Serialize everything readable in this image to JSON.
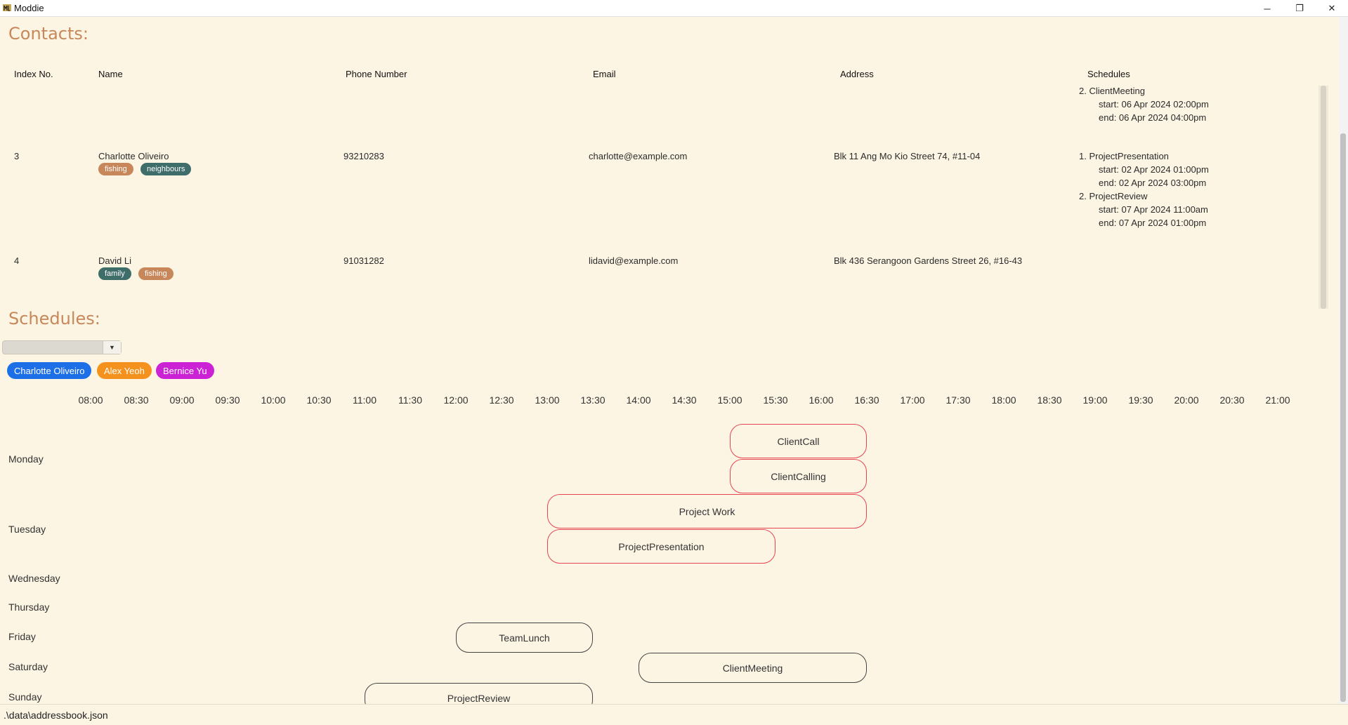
{
  "window": {
    "title": "Moddie",
    "minimize_glyph": "─",
    "maximize_glyph": "❐",
    "close_glyph": "✕"
  },
  "contacts": {
    "title": "Contacts:",
    "columns": [
      "Index No.",
      "Name",
      "Phone Number",
      "Email",
      "Address",
      "Schedules"
    ],
    "partial_row": {
      "schedules": [
        {
          "title": "2. ClientMeeting",
          "start": "start: 06 Apr 2024 02:00pm",
          "end": "end: 06 Apr 2024 04:00pm"
        }
      ]
    },
    "rows": [
      {
        "index": "3",
        "name": "Charlotte Oliveiro",
        "tags": [
          {
            "label": "fishing",
            "color": "#c8875a"
          },
          {
            "label": "neighbours",
            "color": "#3e6d6a"
          }
        ],
        "phone": "93210283",
        "email": "charlotte@example.com",
        "address": "Blk 11 Ang Mo Kio Street 74, #11-04",
        "schedules": [
          {
            "title": "1. ProjectPresentation",
            "start": "start: 02 Apr 2024 01:00pm",
            "end": "end: 02 Apr 2024 03:00pm"
          },
          {
            "title": "2. ProjectReview",
            "start": "start: 07 Apr 2024 11:00am",
            "end": "end: 07 Apr 2024 01:00pm"
          }
        ]
      },
      {
        "index": "4",
        "name": "David Li",
        "tags": [
          {
            "label": "family",
            "color": "#3e6d6a"
          },
          {
            "label": "fishing",
            "color": "#c8875a"
          }
        ],
        "phone": "91031282",
        "email": "lidavid@example.com",
        "address": "Blk 436 Serangoon Gardens Street 26, #16-43",
        "schedules": []
      }
    ]
  },
  "schedules": {
    "title": "Schedules:",
    "dropdown_value": "",
    "chips": [
      {
        "label": "Charlotte Oliveiro",
        "color": "#1d6fe8"
      },
      {
        "label": "Alex Yeoh",
        "color": "#f5921e"
      },
      {
        "label": "Bernice Yu",
        "color": "#cc22d6"
      }
    ],
    "times": [
      "08:00",
      "08:30",
      "09:00",
      "09:30",
      "10:00",
      "10:30",
      "11:00",
      "11:30",
      "12:00",
      "12:30",
      "13:00",
      "13:30",
      "14:00",
      "14:30",
      "15:00",
      "15:30",
      "16:00",
      "16:30",
      "17:00",
      "17:30",
      "18:00",
      "18:30",
      "19:00",
      "19:30",
      "20:00",
      "20:30",
      "21:00"
    ],
    "days": [
      "Monday",
      "Tuesday",
      "Wednesday",
      "Thursday",
      "Friday",
      "Saturday",
      "Sunday"
    ],
    "events": [
      {
        "name": "ClientCall",
        "day": "Monday",
        "start": "15:00",
        "end": "16:30",
        "style": "red",
        "lane": 0
      },
      {
        "name": "ClientCalling",
        "day": "Monday",
        "start": "15:00",
        "end": "16:30",
        "style": "red",
        "lane": 1
      },
      {
        "name": "Project Work",
        "day": "Tuesday",
        "start": "13:00",
        "end": "16:30",
        "style": "red",
        "lane": 0
      },
      {
        "name": "ProjectPresentation",
        "day": "Tuesday",
        "start": "13:00",
        "end": "15:30",
        "style": "red",
        "lane": 1
      },
      {
        "name": "TeamLunch",
        "day": "Friday",
        "start": "12:00",
        "end": "13:30",
        "style": "dark",
        "lane": 0
      },
      {
        "name": "ClientMeeting",
        "day": "Saturday",
        "start": "14:00",
        "end": "16:30",
        "style": "dark",
        "lane": 0
      },
      {
        "name": "ProjectReview",
        "day": "Sunday",
        "start": "11:00",
        "end": "13:30",
        "style": "dark",
        "lane": 0
      }
    ]
  },
  "status": {
    "path": ".\\data\\addressbook.json"
  }
}
